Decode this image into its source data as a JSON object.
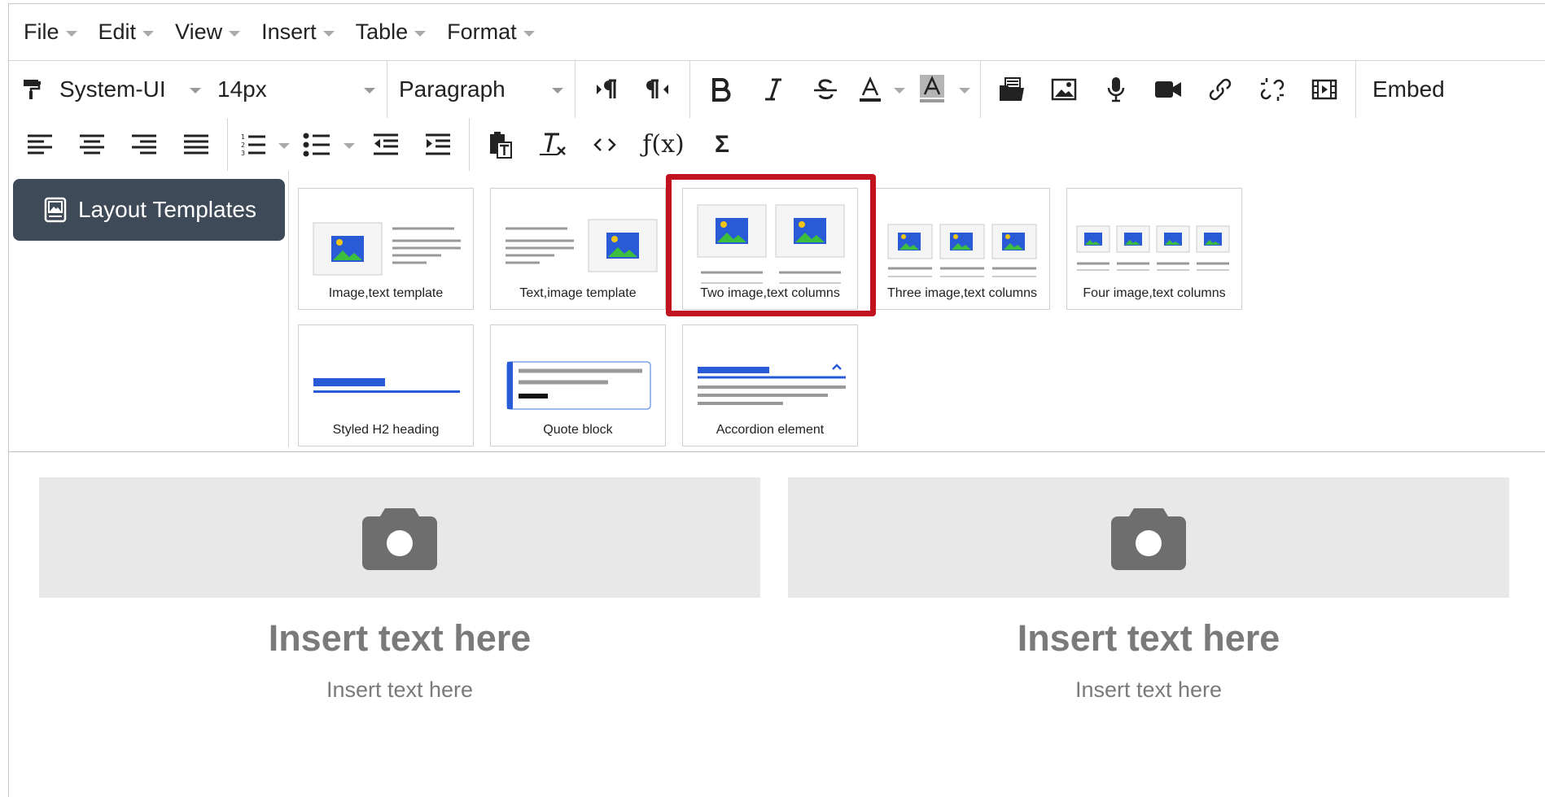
{
  "menubar": {
    "items": [
      {
        "label": "File"
      },
      {
        "label": "Edit"
      },
      {
        "label": "View"
      },
      {
        "label": "Insert"
      },
      {
        "label": "Table"
      },
      {
        "label": "Format"
      }
    ]
  },
  "toolbar": {
    "font_family": "System-UI",
    "font_size": "14px",
    "block_format": "Paragraph",
    "embed_label": "Embed",
    "icons": {
      "row1": [
        "format-painter-icon",
        "ltr-icon",
        "rtl-icon",
        "bold-icon",
        "italic-icon",
        "strikethrough-icon",
        "text-color-icon",
        "background-color-icon",
        "documents-icon",
        "image-icon",
        "record-audio-icon",
        "record-video-icon",
        "link-icon",
        "unlink-icon",
        "media-icon"
      ],
      "row2": [
        "align-left-icon",
        "align-center-icon",
        "align-right-icon",
        "align-justify-icon",
        "ordered-list-icon",
        "unordered-list-icon",
        "outdent-icon",
        "indent-icon",
        "paste-as-text-icon",
        "clear-formatting-icon",
        "source-code-icon",
        "math-icon",
        "equation-icon"
      ]
    },
    "math_label": "ƒ(x)",
    "sigma_label": "Σ"
  },
  "layout_templates": {
    "button_label": "Layout Templates",
    "selected": "Two image,text columns",
    "items": [
      {
        "label": "Image,text template"
      },
      {
        "label": "Text,image template"
      },
      {
        "label": "Two image,text columns"
      },
      {
        "label": "Three image,text columns"
      },
      {
        "label": "Four image,text columns"
      },
      {
        "label": "Styled H2 heading"
      },
      {
        "label": "Quote block"
      },
      {
        "label": "Accordion element"
      }
    ]
  },
  "content": {
    "columns": [
      {
        "title": "Insert text here",
        "text": "Insert text here"
      },
      {
        "title": "Insert text here",
        "text": "Insert text here"
      }
    ]
  },
  "colors": {
    "accent_blue": "#2a5bd7",
    "image_green": "#3dbf3d",
    "highlight_red": "#c1121f",
    "button_dark": "#3e4a58"
  }
}
